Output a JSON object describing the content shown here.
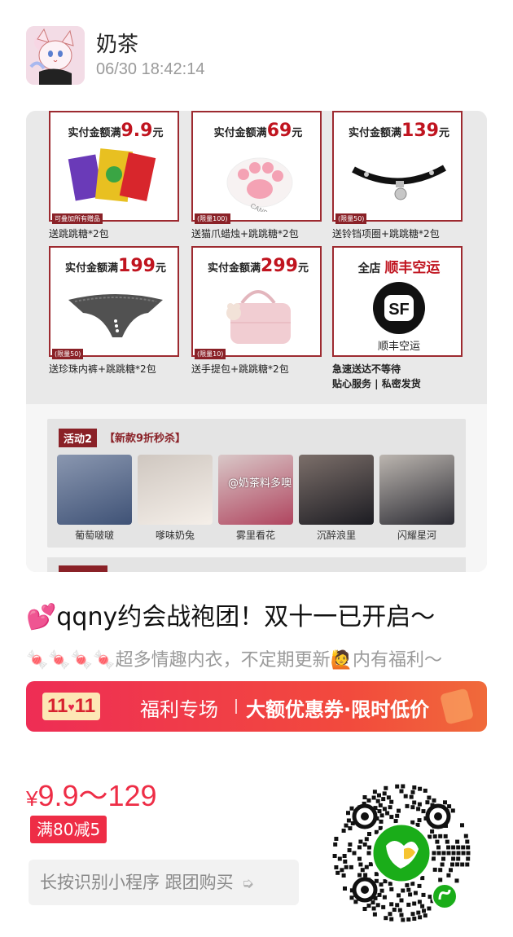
{
  "header": {
    "username": "奶茶",
    "timestamp": "06/30 18:42:14"
  },
  "poster": {
    "cells": [
      {
        "cap_prefix": "实付金额满",
        "cap_value": "9.9",
        "cap_suffix": "元",
        "tag": "可叠加所有赠品",
        "desc": "送跳跳糖*2包"
      },
      {
        "cap_prefix": "实付金额满",
        "cap_value": "69",
        "cap_suffix": "元",
        "tag": "(限量100)",
        "desc": "送猫爪蜡烛+跳跳糖*2包"
      },
      {
        "cap_prefix": "实付金额满",
        "cap_value": "139",
        "cap_suffix": "元",
        "tag": "(限量50)",
        "desc": "送铃铛项圈+跳跳糖*2包"
      },
      {
        "cap_prefix": "实付金额满",
        "cap_value": "199",
        "cap_suffix": "元",
        "tag": "(限量50)",
        "desc": "送珍珠内裤+跳跳糖*2包"
      },
      {
        "cap_prefix": "实付金额满",
        "cap_value": "299",
        "cap_suffix": "元",
        "tag": "(限量10)",
        "desc": "送手提包+跳跳糖*2包"
      },
      {
        "cap_prefix": "全店",
        "cap_value": "顺丰空运",
        "cap_suffix": "",
        "tag": "",
        "desc": "急速送达不等待"
      }
    ],
    "sf_label": "顺丰空运",
    "sf_logo": "SF",
    "cell6_desc2": "贴心服务 | 私密发货",
    "candle_text": "CANDLE",
    "activity": {
      "badge": "活动2",
      "title": "【新款9折秒杀】",
      "watermark": "@奶茶料多噢",
      "items": [
        "葡萄啵啵",
        "嗲味奶兔",
        "雾里看花",
        "沉醉浪里",
        "闪耀星河"
      ]
    }
  },
  "product": {
    "title": "💕qqny约会战袍团！双十一已开启～",
    "subtitle": "🍬🍬🍬🍬超多情趣内衣，不定期更新🙋内有福利～"
  },
  "banner": {
    "badge": "11",
    "badge2": "11",
    "heart": "♥",
    "text1": "福利专场",
    "text2": "大额优惠券·限时低价"
  },
  "price": {
    "currency": "¥",
    "range": "9.9～129",
    "coupon": "满80减5",
    "cta": "长按识别小程序 跟团购买",
    "cta_icon": "hand-pointer-icon"
  },
  "colors": {
    "accent_red": "#ee2d46",
    "poster_maroon": "#8a2127",
    "miniprogram_green": "#1aad19"
  }
}
